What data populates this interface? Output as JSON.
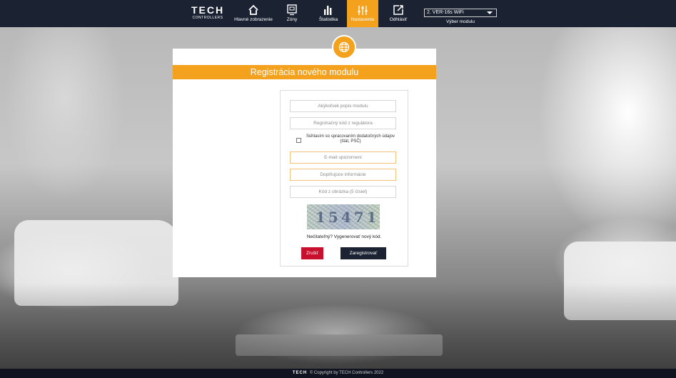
{
  "app": {
    "logo_brand": "TECH",
    "logo_sub": "CONTROLLERS"
  },
  "nav": {
    "items": [
      {
        "label": "Hlavné zobrazenie",
        "icon": "home-icon"
      },
      {
        "label": "Zóny",
        "icon": "zones-icon"
      },
      {
        "label": "Štatistika",
        "icon": "statistics-icon"
      },
      {
        "label": "Nastavenia",
        "icon": "settings-sliders-icon",
        "active": true
      },
      {
        "label": "Odhlásiť",
        "icon": "logout-icon"
      }
    ],
    "module_select_value": "2. VER-16s WiFi",
    "module_select_caption": "Výber modulu"
  },
  "panel": {
    "icon": "globe-icon",
    "title": "Registrácia nového modulu",
    "fields": {
      "description_placeholder": "Akýkoľvek popis modulu",
      "reg_code_placeholder": "Registračný kód z regulátora",
      "email_placeholder": "E-mail upozornení",
      "additional_info_placeholder": "Doplňujúce informácie",
      "captcha_placeholder": "Kód z obrázka (5 čísiel)"
    },
    "consent_label": "Súhlasím so spracovaním dodatočných údajov (štát, PSČ)",
    "captcha_text": "15471",
    "captcha_regenerate": "Nečitateľný? Vygenerovať nový kód.",
    "cancel_label": "Zrušiť",
    "register_label": "Zaregistrovať"
  },
  "footer": {
    "brand": "TECH",
    "text": "© Copyright by TECH Controllers 2022"
  },
  "colors": {
    "accent": "#f4a11d",
    "navbar": "#1b2333",
    "cancel": "#c8102e"
  }
}
